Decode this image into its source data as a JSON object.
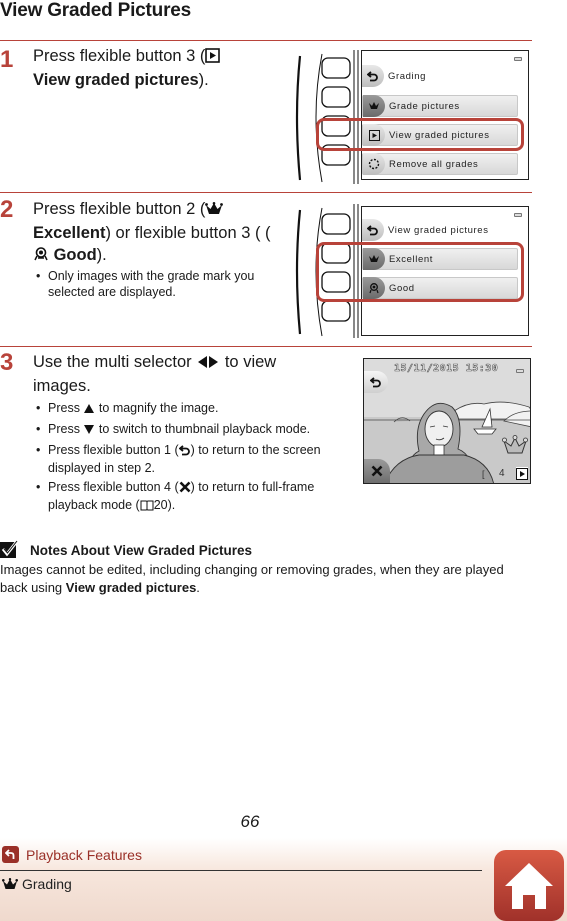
{
  "page": {
    "title": "View Graded Pictures",
    "page_number": "66"
  },
  "colors": {
    "accent": "#b8433a",
    "footer_link": "#9a3028"
  },
  "steps": [
    {
      "number": "1",
      "text_parts": [
        "Press flexible button 3 (",
        "",
        "View graded pictures",
        ")."
      ],
      "icon": "play-icon",
      "camera_menu": {
        "title": "Grading",
        "items": [
          {
            "icon": "crown-icon",
            "label": "Grade pictures"
          },
          {
            "icon": "play-icon",
            "label": "View graded pictures",
            "highlighted": true
          },
          {
            "icon": "dotted-circle-icon",
            "label": "Remove all grades"
          }
        ]
      }
    },
    {
      "number": "2",
      "text_parts": [
        "Press flexible button 2 (",
        "Excellent",
        ") or flexible button 3 (",
        "Good",
        ")."
      ],
      "bullets": [
        "Only images with the grade mark you selected are displayed."
      ],
      "camera_menu": {
        "title": "View graded pictures",
        "items": [
          {
            "icon": "crown-icon",
            "label": "Excellent",
            "highlighted": true
          },
          {
            "icon": "medal-icon",
            "label": "Good",
            "highlighted": true
          }
        ]
      }
    },
    {
      "number": "3",
      "text_line1": "Use the multi selector",
      "text_line1b": "to view",
      "text_line2": "images.",
      "bullets": [
        {
          "pre": "Press",
          "icon": "up-triangle-icon",
          "post": "to magnify the image."
        },
        {
          "pre": "Press",
          "icon": "down-triangle-icon",
          "post": "to switch to thumbnail playback mode."
        },
        {
          "pre": "Press flexible button 1 (",
          "icon": "back-icon",
          "post": ") to return to the screen displayed in step 2."
        },
        {
          "pre": "Press flexible button 4 (",
          "icon": "close-x-icon",
          "post": ") to return to full-frame playback mode (",
          "ref": "20",
          "post2": ")."
        }
      ],
      "playback_screen": {
        "datetime": "15/11/2015 15:30",
        "frame_number": "4"
      }
    }
  ],
  "note": {
    "heading": "Notes About View Graded Pictures",
    "text": "Images cannot be edited, including changing or removing grades, when they are played back using ",
    "text_bold": "View graded pictures",
    "text_end": "."
  },
  "footer": {
    "section_link": "Playback Features",
    "subsection": "Grading"
  }
}
